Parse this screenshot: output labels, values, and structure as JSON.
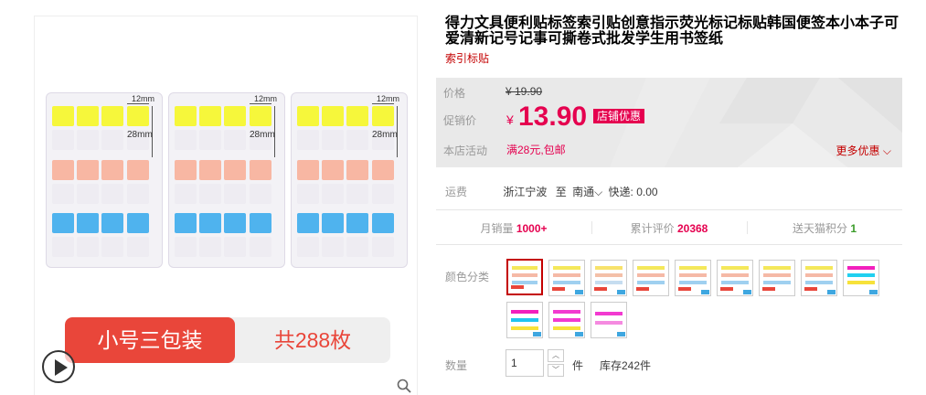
{
  "gallery": {
    "dim_width": "12mm",
    "dim_height": "28mm",
    "banner_left": "小号三包装",
    "banner_right": "共288枚"
  },
  "product": {
    "title": "得力文具便利贴标签索引贴创意指示荧光标记标贴韩国便签本小本子可爱清新记号记事可撕卷式批发学生用书签纸",
    "subtitle": "索引标贴"
  },
  "price": {
    "price_label": "价格",
    "original_price": "¥ 19.90",
    "promo_label": "促销价",
    "currency": "¥",
    "promo_price": "13.90",
    "promo_badge": "店铺优惠",
    "activity_label": "本店活动",
    "activity_text": "满28元,包邮",
    "more_offers": "更多优惠"
  },
  "shipping": {
    "label": "运费",
    "from": "浙江宁波",
    "to_prefix": "至",
    "to": "南通",
    "express": "快递: 0.00"
  },
  "stats": {
    "monthly_label": "月销量",
    "monthly_value": "1000+",
    "reviews_label": "累计评价",
    "reviews_value": "20368",
    "points_label": "送天猫积分",
    "points_value": "1"
  },
  "options": {
    "color_label": "颜色分类"
  },
  "quantity": {
    "label": "数量",
    "value": "1",
    "unit": "件",
    "stock": "库存242件"
  },
  "colors": {
    "promo_red": "#e5004f",
    "banner_red": "#e9463a",
    "price_bg": "#e9e9e9"
  }
}
